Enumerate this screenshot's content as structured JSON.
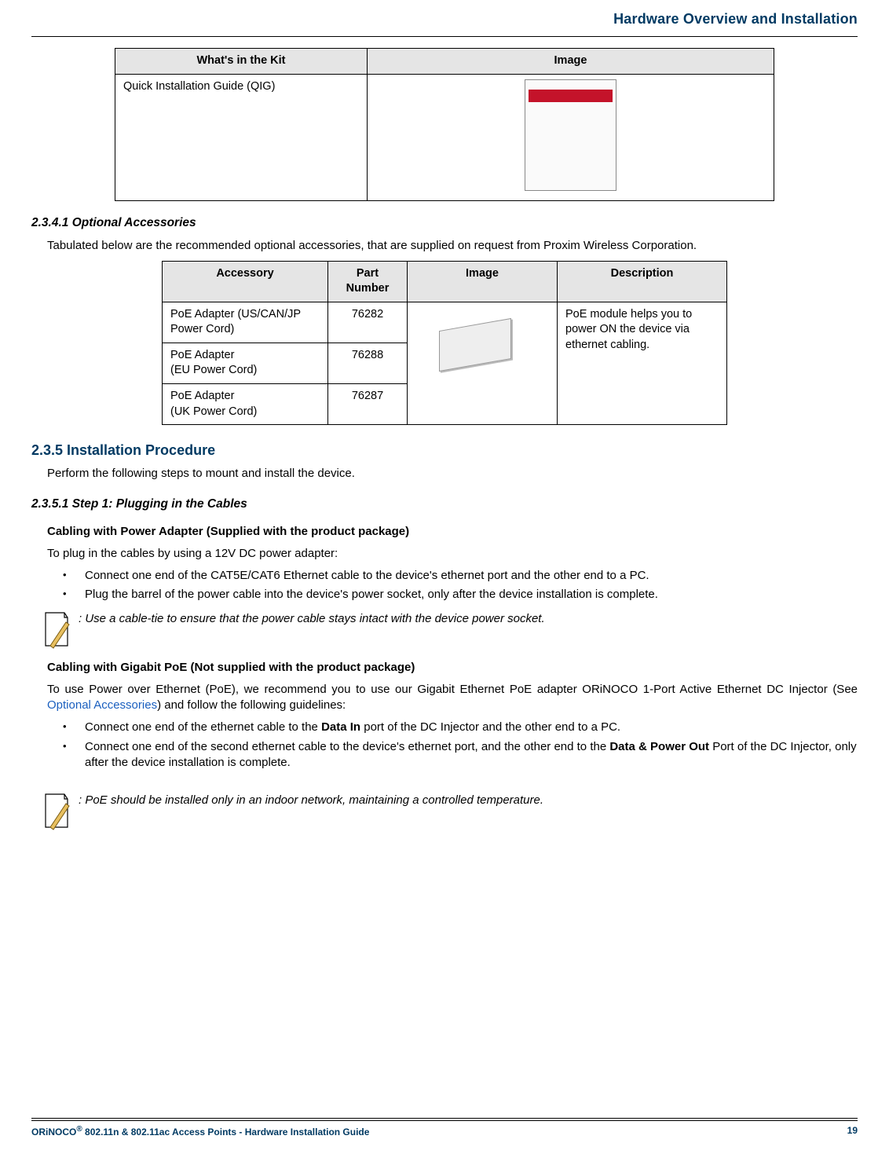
{
  "header": {
    "running_title": "Hardware Overview and Installation"
  },
  "table_kit": {
    "headers": {
      "col1": "What's in the Kit",
      "col2": "Image"
    },
    "rows": [
      {
        "c1": "Quick Installation Guide (QIG)"
      }
    ]
  },
  "sec_optional": {
    "num_title": "2.3.4.1 Optional Accessories",
    "intro": "Tabulated below are the recommended optional accessories, that are supplied on request from Proxim Wireless Corporation."
  },
  "table_acc": {
    "headers": {
      "c1": "Accessory",
      "c2": "Part Number",
      "c3": "Image",
      "c4": "Description"
    },
    "rows": [
      {
        "c1_l1": "PoE Adapter (US/CAN/JP",
        "c1_l2": "Power Cord)",
        "c2": "76282"
      },
      {
        "c1_l1": "PoE Adapter",
        "c1_l2": "(EU Power Cord)",
        "c2": "76288"
      },
      {
        "c1_l1": "PoE Adapter",
        "c1_l2": "(UK Power Cord)",
        "c2": "76287"
      }
    ],
    "desc": "PoE module helps you to power ON the device via ethernet cabling."
  },
  "sec_install": {
    "title": "2.3.5 Installation Procedure",
    "intro": "Perform the following steps to mount and install the device."
  },
  "sec_step1": {
    "title": "2.3.5.1 Step 1: Plugging in the Cables",
    "sub1": "Cabling with Power Adapter (Supplied with the product package)",
    "p1": "To plug in the cables by using a 12V DC power adapter:",
    "bullets1": [
      "Connect one end of the CAT5E/CAT6 Ethernet cable to the device's ethernet port and the other end to a PC.",
      "Plug the barrel of the power cable into the device's power socket, only after the device installation is complete."
    ],
    "note1": ": Use a cable-tie to ensure that the power cable stays intact with the device power socket.",
    "sub2": "Cabling with Gigabit PoE (Not supplied with the product package)",
    "p2_a": "To use Power over Ethernet (PoE), we recommend you to use our Gigabit Ethernet PoE adapter ORiNOCO 1-Port Active Ethernet DC Injector (See ",
    "p2_link": "Optional Accessories",
    "p2_b": ") and follow the following guidelines:",
    "bullets2_a": "Connect one end of the ethernet cable to the ",
    "bullets2_a_bold": "Data In",
    "bullets2_a2": " port of the DC Injector and the other end to a PC.",
    "bullets2_b": "Connect one end of the second ethernet cable to the device's ethernet port, and the other end to the ",
    "bullets2_b_bold": "Data & Power Out",
    "bullets2_b2": " Port of the DC Injector, only after the device installation is complete.",
    "note2": ": PoE should be installed only in an indoor network, maintaining a controlled temperature."
  },
  "footer": {
    "left_a": "ORiNOCO",
    "left_sup": "®",
    "left_b": " 802.11n & 802.11ac Access Points - Hardware Installation Guide",
    "page": "19"
  }
}
